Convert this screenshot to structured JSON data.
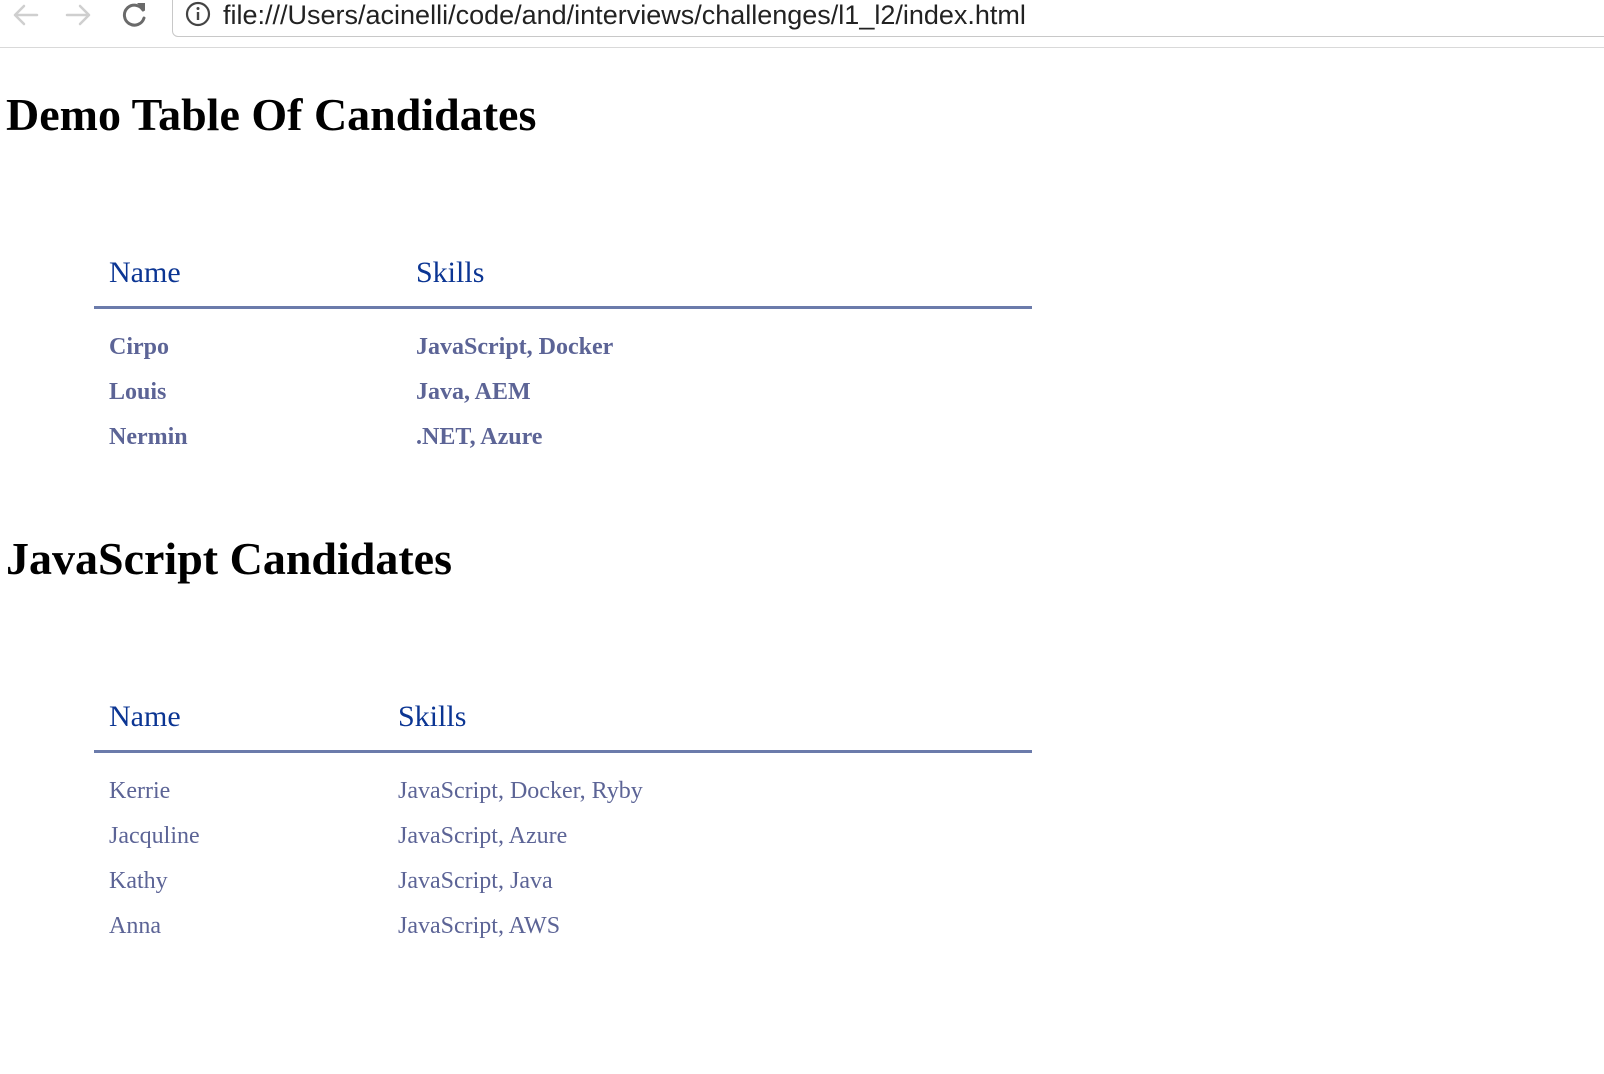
{
  "browser": {
    "url": "file:///Users/acinelli/code/and/interviews/challenges/l1_l2/index.html"
  },
  "sections": [
    {
      "title": "Demo Table Of Candidates",
      "headers": {
        "name": "Name",
        "skills": "Skills"
      },
      "rows": [
        {
          "name": "Cirpo",
          "skills": "JavaScript, Docker"
        },
        {
          "name": "Louis",
          "skills": "Java, AEM"
        },
        {
          "name": "Nermin",
          "skills": ".NET, Azure"
        }
      ]
    },
    {
      "title": "JavaScript Candidates",
      "headers": {
        "name": "Name",
        "skills": "Skills"
      },
      "rows": [
        {
          "name": "Kerrie",
          "skills": "JavaScript, Docker, Ryby"
        },
        {
          "name": "Jacquline",
          "skills": "JavaScript, Azure"
        },
        {
          "name": "Kathy",
          "skills": "JavaScript, Java"
        },
        {
          "name": "Anna",
          "skills": "JavaScript, AWS"
        }
      ]
    }
  ],
  "colors": {
    "heading": "#000000",
    "table_header": "#0b3593",
    "table_cell": "#5c6496",
    "table_rule": "#6b7bab"
  },
  "icons": {
    "back": "arrow-left-icon",
    "forward": "arrow-right-icon",
    "reload": "reload-icon",
    "info": "info-icon"
  }
}
